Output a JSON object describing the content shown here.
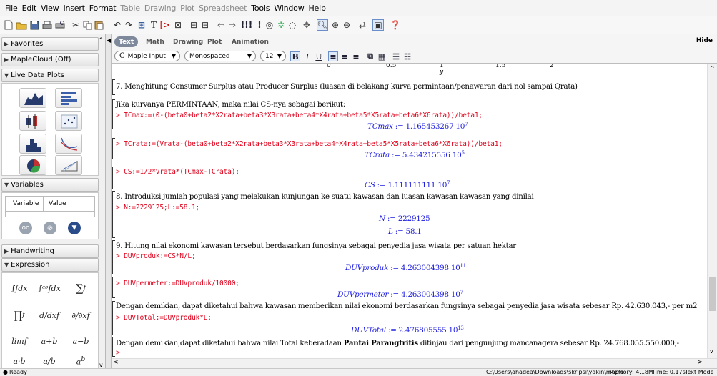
{
  "menu": [
    "File",
    "Edit",
    "View",
    "Insert",
    "Format",
    "Table",
    "Drawing",
    "Plot",
    "Spreadsheet",
    "Tools",
    "Window",
    "Help"
  ],
  "menu_disabled": [
    "Table",
    "Drawing",
    "Plot",
    "Spreadsheet"
  ],
  "palette": {
    "favorites": "Favorites",
    "maplecloud": "MapleCloud (Off)",
    "live_plots": "Live Data Plots",
    "variables": "Variables",
    "var_col1": "Variable",
    "var_col2": "Value",
    "handwriting": "Handwriting",
    "expression": "Expression"
  },
  "context": {
    "tabs": [
      "Text",
      "Math",
      "Drawing",
      "Plot",
      "Animation"
    ],
    "hide": "Hide",
    "input_mode": "Maple Input",
    "font": "Monospaced",
    "size": "12"
  },
  "worksheet": {
    "axis_ticks": [
      "0",
      "0.5",
      "1",
      "1.5",
      "2"
    ],
    "axis_y": "y",
    "t7": "7.  Menghitung Consumer Surplus atau Producer Surplus (luasan di belakang kurva permintaan/penawaran dari nol sampai Qrata)",
    "t_jika": "Jika kurvanya PERMINTAAN, maka nilai CS-nya sebagai berikut:",
    "c1": "TCmax:=(0-(beta0+beta2*X2rata+beta3*X3rata+beta4*X4rata+beta5*X5rata+beta6*X6rata))/beta1;",
    "o1_lhs": "TCmax",
    "o1_val": " := 1.165453267 10",
    "o1_exp": "7",
    "c2": "TCrata:=(Vrata-(beta0+beta2*X2rata+beta3*X3rata+beta4*X4rata+beta5*X5rata+beta6*X6rata))/beta1;",
    "o2_lhs": "TCrata",
    "o2_val": " := 5.434215556 10",
    "o2_exp": "5",
    "c3": "CS:=1/2*Vrata*(TCmax-TCrata);",
    "o3_lhs": "CS",
    "o3_val": " := 1.111111111 10",
    "o3_exp": "7",
    "t8": "8.  Introduksi jumlah populasi yang melakukan kunjungan ke suatu kawasan dan luasan kawasan kawasan yang dinilai",
    "c4": "N:=2229125;L:=58.1;",
    "o4_lhs": "N",
    "o4_val": " := 2229125",
    "o5_lhs": "L",
    "o5_val": " := 58.1",
    "t9": "9.  Hitung nilai ekonomi kawasan tersebut berdasarkan fungsinya sebagai penyedia jasa wisata per satuan hektar",
    "c5": "DUVproduk:=CS*N/L;",
    "o6_lhs": "DUVproduk",
    "o6_val": " := 4.263004398 10",
    "o6_exp": "11",
    "c6": "DUVpermeter:=DUVproduk/10000;",
    "o7_lhs": "DUVpermeter",
    "o7_val": " := 4.263004398 10",
    "o7_exp": "7",
    "t10": "Dengan demikian, dapat diketahui bahwa kawasan memberikan nilai ekonomi berdasarkan fungsinya sebagai penyedia jasa wisata sebesar Rp. 42.630.043,- per m2",
    "c7": "DUVTotal:=DUVproduk*L;",
    "o8_lhs": "DUVTotal",
    "o8_val": " := 2.476805555 10",
    "o8_exp": "13",
    "t11a": "Dengan demikian,dapat diketahui bahwa nilai Total keberadaan ",
    "t11b": "Pantai Parangtritis",
    "t11c": " ditinjau dari pengunjung mancanagera sebesar Rp. 24.768.055.550.000,-",
    "prompt": ">"
  },
  "status": {
    "ready": "Ready",
    "path": "C:\\Users\\ahadea\\Downloads\\skripsi\\yakin\\maple",
    "memory": "Memory: 4.18M",
    "time": "Time: 0.17s",
    "mode": "Text Mode"
  },
  "colors": {
    "command": "#e0001a",
    "output": "#1d1de0"
  }
}
